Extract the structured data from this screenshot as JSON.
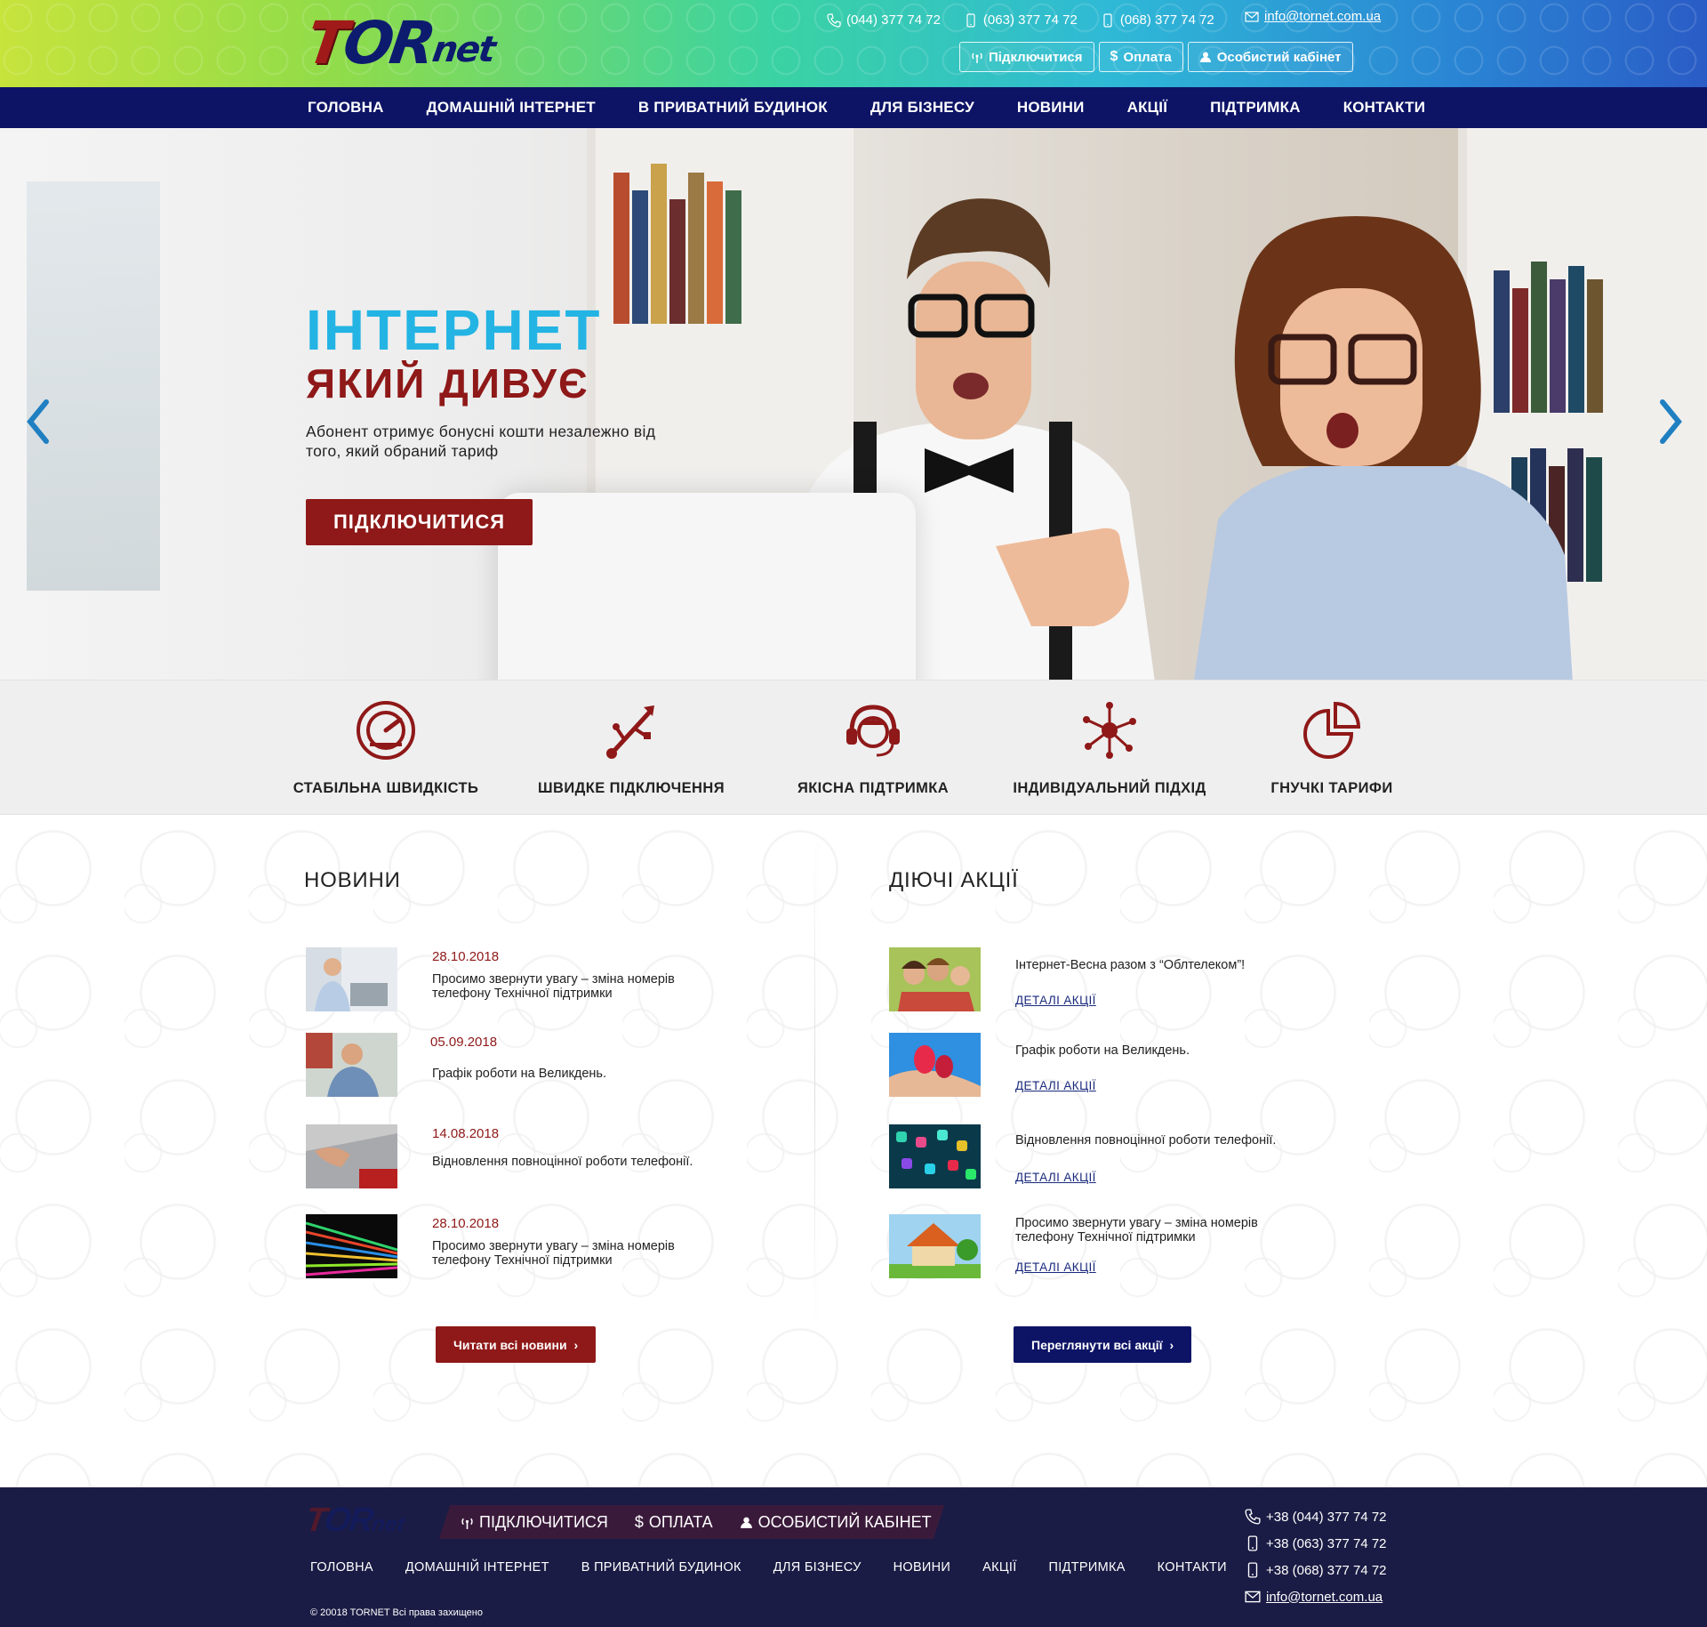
{
  "header": {
    "logo": {
      "part1": "T",
      "part2": "OR",
      "part3": "net"
    },
    "phones": [
      "(044) 377 74 72",
      "(063) 377 74 72",
      "(068) 377 74 72"
    ],
    "email": "info@tornet.com.ua",
    "buttons": {
      "connect": "Підключитися",
      "payment": "Оплата",
      "cabinet": "Особистий кабінет"
    }
  },
  "nav": {
    "items": [
      "ГОЛОВНА",
      "ДОМАШНІЙ ІНТЕРНЕТ",
      "В ПРИВАТНИЙ БУДИНОК",
      "ДЛЯ БІЗНЕСУ",
      "НОВИНИ",
      "АКЦІЇ",
      "ПІДТРИМКА",
      "КОНТАКТИ"
    ]
  },
  "hero": {
    "title1": "ІНТЕРНЕТ",
    "title2": "ЯКИЙ ДИВУЄ",
    "text": "Абонент отримує бонусні кошти незалежно від того, який обраний тариф",
    "button": "ПІДКЛЮЧИТИСЯ"
  },
  "features": [
    {
      "label": "СТАБІЛЬНА ШВИДКІСТЬ",
      "icon": "speedometer-icon"
    },
    {
      "label": "ШВИДКЕ  ПІДКЛЮЧЕННЯ",
      "icon": "usb-icon"
    },
    {
      "label": "ЯКІСНА ПІДТРИМКА",
      "icon": "support-headset-icon"
    },
    {
      "label": "ІНДИВІДУАЛЬНИЙ ПІДХІД",
      "icon": "network-nodes-icon"
    },
    {
      "label": "ГНУЧКІ ТАРИФИ",
      "icon": "pie-chart-icon"
    }
  ],
  "news": {
    "title": "НОВИНИ",
    "items": [
      {
        "date": "28.10.2018",
        "text": "Просимо звернути увагу – зміна номерів телефону Технічної підтримки"
      },
      {
        "date": "05.09.2018",
        "text": "Графік роботи на Великдень."
      },
      {
        "date": "14.08.2018",
        "text": "Відновлення повноцінної роботи телефонії."
      },
      {
        "date": "28.10.2018",
        "text": "Просимо звернути увагу – зміна номерів телефону Технічної підтримки"
      }
    ],
    "button": "Читати всі новини"
  },
  "promos": {
    "title": "ДІЮЧІ АКЦІЇ",
    "link_label": "ДЕТАЛІ АКЦІЇ",
    "items": [
      {
        "text": "Інтернет-Весна разом з “Облтелеком”!"
      },
      {
        "text": "Графік роботи на Великдень."
      },
      {
        "text": "Відновлення повноцінної роботи телефонії."
      },
      {
        "text": "Просимо звернути увагу – зміна номерів телефону Технічної підтримки"
      }
    ],
    "button": "Переглянути всі акції"
  },
  "footer": {
    "links": {
      "connect": "ПІДКЛЮЧИТИСЯ",
      "payment": "ОПЛАТА",
      "cabinet": "ОСОБИСТИЙ КАБІНЕТ"
    },
    "nav": [
      "ГОЛОВНА",
      "ДОМАШНІЙ ІНТЕРНЕТ",
      "В ПРИВАТНИЙ БУДИНОК",
      "ДЛЯ БІЗНЕСУ",
      "НОВИНИ",
      "АКЦІЇ",
      "ПІДТРИМКА",
      "КОНТАКТИ"
    ],
    "copyright": "© 20018 TORNET Всі права захищено",
    "phones": [
      "+38 (044) 377 74 72",
      "+38 (063) 377 74 72",
      "+38 (068) 377 74 72"
    ],
    "email": "info@tornet.com.ua"
  },
  "colors": {
    "brand_red": "#8f1818",
    "brand_navy": "#0d1466",
    "accent_cyan": "#24b4e4"
  }
}
